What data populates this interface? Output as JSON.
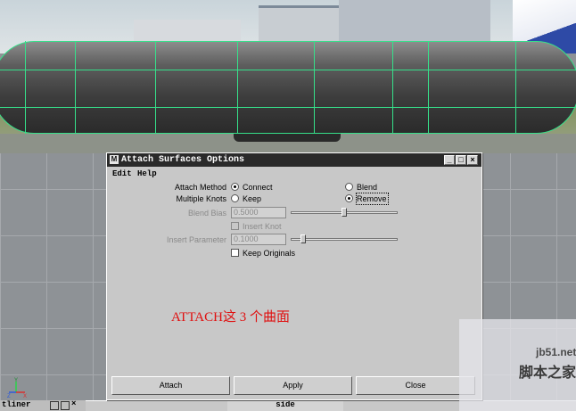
{
  "dialog": {
    "title": "Attach Surfaces Options",
    "menus": [
      "Edit",
      "Help"
    ],
    "window_buttons": [
      "_",
      "□",
      "×"
    ],
    "attach_method": {
      "label": "Attach Method",
      "options": [
        "Connect",
        "Blend"
      ],
      "selected": "Connect"
    },
    "multiple_knots": {
      "label": "Multiple Knots",
      "options": [
        "Keep",
        "Remove"
      ],
      "selected": "Remove"
    },
    "blend_bias": {
      "label": "Blend Bias",
      "value": "0.5000",
      "slider_fraction": 0.5,
      "enabled": false
    },
    "insert_knot": {
      "label": "Insert Knot",
      "checked": false,
      "enabled": false
    },
    "insert_parameter": {
      "label": "Insert Parameter",
      "value": "0.1000",
      "slider_fraction": 0.1,
      "enabled": false
    },
    "keep_originals": {
      "label": "Keep Originals",
      "checked": false
    },
    "annotation": "ATTACH这 3 个曲面",
    "buttons": {
      "attach": "Attach",
      "apply": "Apply",
      "close": "Close"
    }
  },
  "viewport": {
    "panel_tab_left": "tliner",
    "panel_tab_side": "side",
    "axis_labels": {
      "y": "Y",
      "z": "Z",
      "x": "X"
    }
  },
  "watermark": {
    "url": "jb51.net",
    "site": "脚本之家"
  },
  "colors": {
    "isoparm": "#36e08a",
    "annotation": "#e01010",
    "titlebar": "#2a2a2a"
  }
}
